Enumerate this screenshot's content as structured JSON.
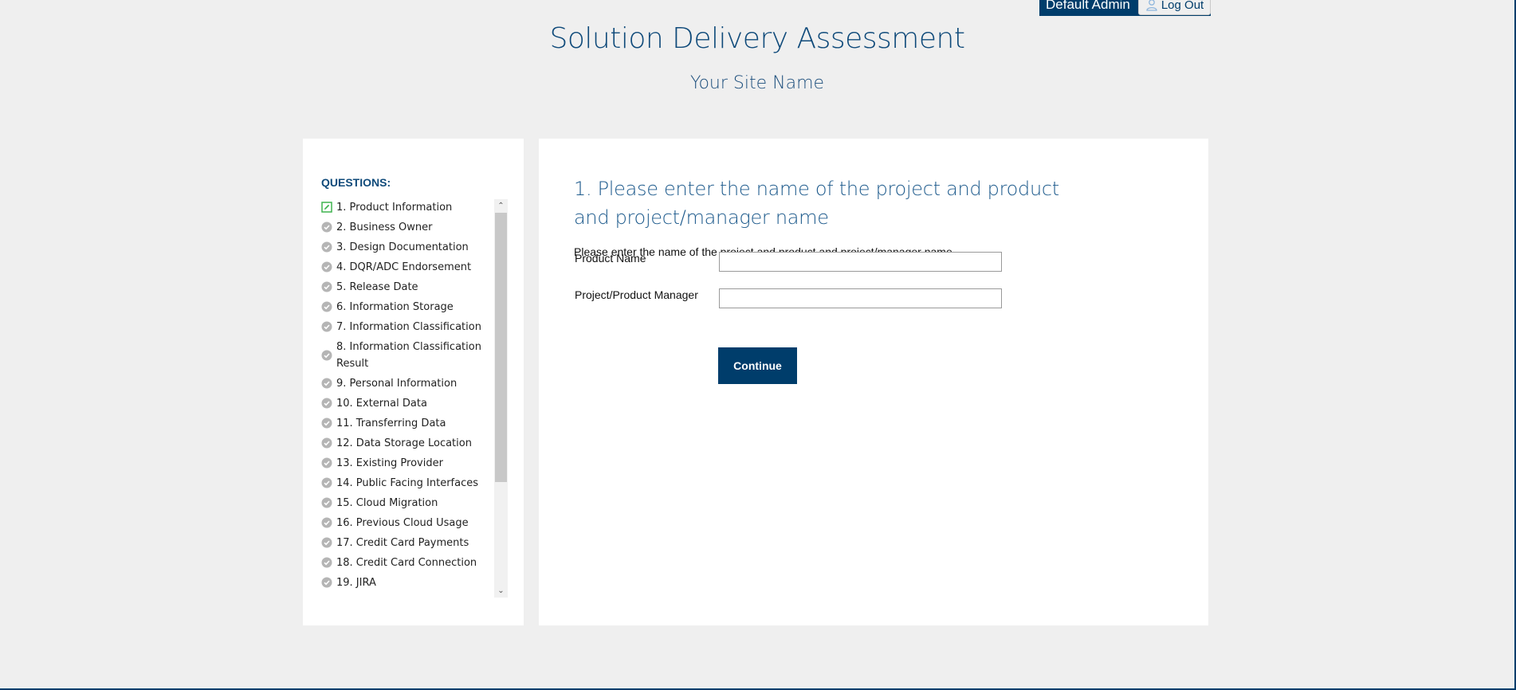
{
  "header": {
    "user_name": "Default Admin",
    "logout_label": "Log Out",
    "title": "Solution Delivery Assessment",
    "site_name": "Your Site Name"
  },
  "sidebar": {
    "heading": "QUESTIONS:",
    "items": [
      {
        "label": "1. Product Information",
        "icon": "edit-icon",
        "state": "current"
      },
      {
        "label": "2. Business Owner",
        "icon": "check-circle-icon",
        "state": "pending"
      },
      {
        "label": "3. Design Documentation",
        "icon": "check-circle-icon",
        "state": "pending"
      },
      {
        "label": "4. DQR/ADC Endorsement",
        "icon": "check-circle-icon",
        "state": "pending"
      },
      {
        "label": "5. Release Date",
        "icon": "check-circle-icon",
        "state": "pending"
      },
      {
        "label": "6. Information Storage",
        "icon": "check-circle-icon",
        "state": "pending"
      },
      {
        "label": "7. Information Classification",
        "icon": "check-circle-icon",
        "state": "pending"
      },
      {
        "label": "8. Information Classification Result",
        "icon": "check-circle-icon",
        "state": "pending"
      },
      {
        "label": "9. Personal Information",
        "icon": "check-circle-icon",
        "state": "pending"
      },
      {
        "label": "10. External Data",
        "icon": "check-circle-icon",
        "state": "pending"
      },
      {
        "label": "11. Transferring Data",
        "icon": "check-circle-icon",
        "state": "pending"
      },
      {
        "label": "12. Data Storage Location",
        "icon": "check-circle-icon",
        "state": "pending"
      },
      {
        "label": "13. Existing Provider",
        "icon": "check-circle-icon",
        "state": "pending"
      },
      {
        "label": "14. Public Facing Interfaces",
        "icon": "check-circle-icon",
        "state": "pending"
      },
      {
        "label": "15. Cloud Migration",
        "icon": "check-circle-icon",
        "state": "pending"
      },
      {
        "label": "16. Previous Cloud Usage",
        "icon": "check-circle-icon",
        "state": "pending"
      },
      {
        "label": "17. Credit Card Payments",
        "icon": "check-circle-icon",
        "state": "pending"
      },
      {
        "label": "18. Credit Card Connection",
        "icon": "check-circle-icon",
        "state": "pending"
      },
      {
        "label": "19. JIRA",
        "icon": "check-circle-icon",
        "state": "pending"
      }
    ]
  },
  "main": {
    "question_title": "1. Please enter the name of the project and product and project/manager name",
    "question_description": "Please enter the name of the project and product and project/manager name",
    "fields": [
      {
        "label": "Product Name",
        "value": "",
        "placeholder": ""
      },
      {
        "label": "Project/Product Manager",
        "value": "",
        "placeholder": ""
      }
    ],
    "continue_label": "Continue"
  },
  "colors": {
    "brand": "#003d6b",
    "title": "#0f4a7a",
    "current_icon": "#3fb34f",
    "pending_icon": "#b5b5b5",
    "background": "#efefef"
  }
}
